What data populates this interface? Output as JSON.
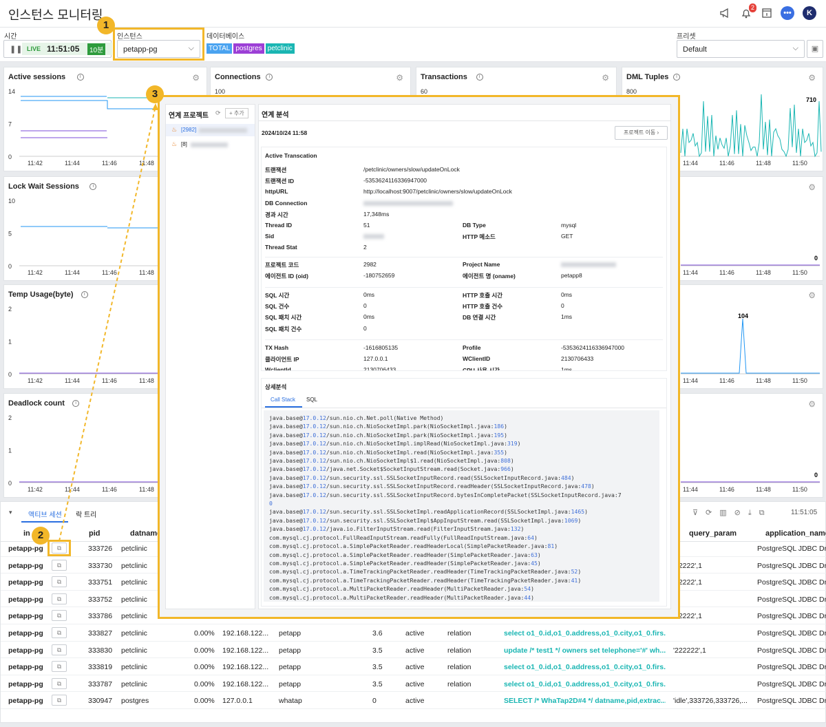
{
  "app": {
    "title": "인스턴스 모니터링",
    "notif_count": "2",
    "avatar": "K"
  },
  "filters": {
    "time_label": "시간",
    "live": "LIVE",
    "time": "11:51:05",
    "range": "10분",
    "instance_label": "인스턴스",
    "instance_value": "petapp-pg",
    "db_label": "데이터베이스",
    "db_tags": [
      "TOTAL",
      "postgres",
      "petclinic"
    ],
    "preset_label": "프리셋",
    "preset_value": "Default"
  },
  "colors": {
    "accent": "#2196f3",
    "teal": "#1ab6b3",
    "purple": "#7b4bd8",
    "callout": "#f2b729"
  },
  "panels": [
    {
      "title": "Active sessions",
      "y": [
        "14",
        "7",
        "0"
      ],
      "x": [
        "11:42",
        "11:44",
        "11:46",
        "11:48"
      ]
    },
    {
      "title": "Connections",
      "y": [
        "100"
      ],
      "x": []
    },
    {
      "title": "Transactions",
      "y": [
        "60"
      ],
      "x": []
    },
    {
      "title": "DML Tuples",
      "y": [
        "800"
      ],
      "x": [
        "11:44",
        "11:46",
        "11:48",
        "11:50"
      ],
      "peak": "710"
    },
    {
      "title": "Lock Wait Sessions",
      "y": [
        "10",
        "5",
        "0"
      ],
      "x": [
        "11:42",
        "11:44",
        "11:46",
        "11:48"
      ]
    },
    {
      "title": "",
      "x": [
        "11:44",
        "11:46",
        "11:48",
        "11:50"
      ],
      "peak": "0"
    },
    {
      "title": "Temp Usage(byte)",
      "y": [
        "2",
        "1",
        "0"
      ],
      "x": [
        "11:42",
        "11:44",
        "11:46",
        "11:48"
      ]
    },
    {
      "title": "",
      "x": [
        "11:44",
        "11:46",
        "11:48",
        "11:50"
      ],
      "peak": "104"
    },
    {
      "title": "Deadlock count",
      "y": [
        "2",
        "1",
        "0"
      ],
      "x": [
        "11:42",
        "11:44",
        "11:46",
        "11:48"
      ]
    },
    {
      "title": "",
      "x": [
        "11:44",
        "11:46",
        "11:48",
        "11:50"
      ],
      "peak": "0"
    }
  ],
  "table": {
    "tabs": [
      "액티브 세션",
      "락 트리"
    ],
    "time": "11:51:05",
    "headers": [
      "in",
      "pid",
      "datname",
      "query_param",
      "application_name"
    ],
    "rows": [
      {
        "inst": "petapp-pg",
        "pid": "333726",
        "db": "petclinic",
        "cpu": "",
        "ip": "",
        "user": "",
        "time": "",
        "state": "",
        "wait": "",
        "query": "",
        "param": "",
        "app": "PostgreSQL JDBC Dr"
      },
      {
        "inst": "petapp-pg",
        "pid": "333730",
        "db": "petclinic",
        "cpu": "",
        "ip": "",
        "user": "",
        "time": "",
        "state": "",
        "wait": "",
        "query": "",
        "param": "'22222',1",
        "app": "PostgreSQL JDBC Dr"
      },
      {
        "inst": "petapp-pg",
        "pid": "333751",
        "db": "petclinic",
        "cpu": "",
        "ip": "",
        "user": "",
        "time": "",
        "state": "",
        "wait": "",
        "query": "",
        "param": "'22222',1",
        "app": "PostgreSQL JDBC Dr"
      },
      {
        "inst": "petapp-pg",
        "pid": "333752",
        "db": "petclinic",
        "cpu": "",
        "ip": "",
        "user": "",
        "time": "",
        "state": "",
        "wait": "",
        "query": "",
        "param": "",
        "app": "PostgreSQL JDBC Dr"
      },
      {
        "inst": "petapp-pg",
        "pid": "333786",
        "db": "petclinic",
        "cpu": "",
        "ip": "",
        "user": "",
        "time": "",
        "state": "",
        "wait": "",
        "query": "",
        "param": "'22222',1",
        "app": "PostgreSQL JDBC Dr"
      },
      {
        "inst": "petapp-pg",
        "pid": "333827",
        "db": "petclinic",
        "cpu": "0.00%",
        "ip": "192.168.122...",
        "user": "petapp",
        "time": "3.6",
        "state": "active",
        "wait": "relation",
        "query": "select o1_0.id,o1_0.address,o1_0.city,o1_0.firs...",
        "param": "",
        "app": "PostgreSQL JDBC Dr"
      },
      {
        "inst": "petapp-pg",
        "pid": "333830",
        "db": "petclinic",
        "cpu": "0.00%",
        "ip": "192.168.122...",
        "user": "petapp",
        "time": "3.5",
        "state": "active",
        "wait": "relation",
        "query": "update /* test1 */ owners set telephone='#' wh...",
        "param": "'222222',1",
        "app": "PostgreSQL JDBC Dr"
      },
      {
        "inst": "petapp-pg",
        "pid": "333819",
        "db": "petclinic",
        "cpu": "0.00%",
        "ip": "192.168.122...",
        "user": "petapp",
        "time": "3.5",
        "state": "active",
        "wait": "relation",
        "query": "select o1_0.id,o1_0.address,o1_0.city,o1_0.firs...",
        "param": "",
        "app": "PostgreSQL JDBC Dr"
      },
      {
        "inst": "petapp-pg",
        "pid": "333787",
        "db": "petclinic",
        "cpu": "0.00%",
        "ip": "192.168.122...",
        "user": "petapp",
        "time": "3.5",
        "state": "active",
        "wait": "relation",
        "query": "select o1_0.id,o1_0.address,o1_0.city,o1_0.firs...",
        "param": "",
        "app": "PostgreSQL JDBC Dr"
      },
      {
        "inst": "petapp-pg",
        "pid": "330947",
        "db": "postgres",
        "cpu": "0.00%",
        "ip": "127.0.0.1",
        "user": "whatap",
        "time": "0",
        "state": "active",
        "wait": "",
        "query": "SELECT /* WhaTap2D#4 */ datname,pid,extrac...",
        "param": "'idle',333726,333726,...",
        "app": "PostgreSQL JDBC Dr"
      }
    ]
  },
  "modal": {
    "left_title": "연계 프로젝트",
    "add": "+ 추가",
    "projects": [
      "[2982]",
      "[8]"
    ],
    "right_title": "연계 분석",
    "date": "2024/10/24 11:58",
    "move": "프로젝트 이동",
    "section": "Active Transcation",
    "fields1": [
      [
        "트랜잭션",
        "/petclinic/owners/slow/updateOnLock"
      ],
      [
        "트랜잭션 ID",
        "-5353624116336947000"
      ],
      [
        "httpURL",
        "http://localhost:9007/petclinic/owners/slow/updateOnLock"
      ],
      [
        "DB Connection",
        ""
      ],
      [
        "경과 시간",
        "17,348ms"
      ],
      [
        "Thread ID",
        "51"
      ],
      [
        "Sid",
        ""
      ],
      [
        "Thread Stat",
        "2"
      ]
    ],
    "fields1r": [
      [
        "DB Type",
        "mysql"
      ],
      [
        "HTTP 메소드",
        "GET"
      ]
    ],
    "fields2": [
      [
        "프로젝트 코드",
        "2982"
      ],
      [
        "에이전트 ID (oid)",
        "-180752659"
      ]
    ],
    "fields2r": [
      [
        "Project Name",
        ""
      ],
      [
        "에이전트 명 (oname)",
        "petapp8"
      ]
    ],
    "fields3": [
      [
        "SQL 시간",
        "0ms"
      ],
      [
        "SQL 건수",
        "0"
      ],
      [
        "SQL 패치 시간",
        "0ms"
      ],
      [
        "SQL 패치 건수",
        "0"
      ]
    ],
    "fields3r": [
      [
        "HTTP 호출 시간",
        "0ms"
      ],
      [
        "HTTP 호출 건수",
        "0"
      ],
      [
        "DB 연결 시간",
        "1ms"
      ]
    ],
    "fields4": [
      [
        "TX Hash",
        "-1616805135"
      ],
      [
        "클라이언트 IP",
        "127.0.0.1"
      ],
      [
        "WclientId",
        "2130706433"
      ]
    ],
    "fields4r": [
      [
        "Profile",
        "-5353624116336947000"
      ],
      [
        "WClientID",
        "2130706433"
      ],
      [
        "CPU 사용 시간",
        "1ms"
      ]
    ],
    "detail_title": "상세분석",
    "detail_tabs": [
      "Call Stack",
      "SQL"
    ],
    "stack": [
      [
        "java.base@",
        "17.0.12",
        "/sun.nio.ch.Net.poll(Native Method)",
        ""
      ],
      [
        "java.base@",
        "17.0.12",
        "/sun.nio.ch.NioSocketImpl.park(NioSocketImpl.java:",
        "186"
      ],
      [
        "java.base@",
        "17.0.12",
        "/sun.nio.ch.NioSocketImpl.park(NioSocketImpl.java:",
        "195"
      ],
      [
        "java.base@",
        "17.0.12",
        "/sun.nio.ch.NioSocketImpl.implRead(NioSocketImpl.java:",
        "319"
      ],
      [
        "java.base@",
        "17.0.12",
        "/sun.nio.ch.NioSocketImpl.read(NioSocketImpl.java:",
        "355"
      ],
      [
        "java.base@",
        "17.0.12",
        "/sun.nio.ch.NioSocketImpl$1.read(NioSocketImpl.java:",
        "808"
      ],
      [
        "java.base@",
        "17.0.12",
        "/java.net.Socket$SocketInputStream.read(Socket.java:",
        "966"
      ],
      [
        "java.base@",
        "17.0.12",
        "/sun.security.ssl.SSLSocketInputRecord.read(SSLSocketInputRecord.java:",
        "484"
      ],
      [
        "java.base@",
        "17.0.12",
        "/sun.security.ssl.SSLSocketInputRecord.readHeader(SSLSocketInputRecord.java:",
        "478"
      ],
      [
        "java.base@",
        "17.0.12",
        "/sun.security.ssl.SSLSocketInputRecord.bytesInCompletePacket(SSLSocketInputRecord.java:7",
        ""
      ],
      [
        "",
        "",
        "",
        "0"
      ],
      [
        "java.base@",
        "17.0.12",
        "/sun.security.ssl.SSLSocketImpl.readApplicationRecord(SSLSocketImpl.java:",
        "1465"
      ],
      [
        "java.base@",
        "17.0.12",
        "/sun.security.ssl.SSLSocketImpl$AppInputStream.read(SSLSocketImpl.java:",
        "1069"
      ],
      [
        "java.base@",
        "17.0.12",
        "/java.io.FilterInputStream.read(FilterInputStream.java:",
        "132"
      ],
      [
        "com.mysql.cj.protocol.FullReadInputStream.readFully(FullReadInputStream.java:",
        "",
        "",
        "64"
      ],
      [
        "com.mysql.cj.protocol.a.SimplePacketReader.readHeaderLocal(SimplePacketReader.java:",
        "",
        "",
        "81"
      ],
      [
        "com.mysql.cj.protocol.a.SimplePacketReader.readHeader(SimplePacketReader.java:",
        "",
        "",
        "63"
      ],
      [
        "com.mysql.cj.protocol.a.SimplePacketReader.readHeader(SimplePacketReader.java:",
        "",
        "",
        "45"
      ],
      [
        "com.mysql.cj.protocol.a.TimeTrackingPacketReader.readHeader(TimeTrackingPacketReader.java:",
        "",
        "",
        "52"
      ],
      [
        "com.mysql.cj.protocol.a.TimeTrackingPacketReader.readHeader(TimeTrackingPacketReader.java:",
        "",
        "",
        "41"
      ],
      [
        "com.mysql.cj.protocol.a.MultiPacketReader.readHeader(MultiPacketReader.java:",
        "",
        "",
        "54"
      ],
      [
        "com.mysql.cj.protocol.a.MultiPacketReader.readHeader(MultiPacketReader.java:",
        "",
        "",
        "44"
      ]
    ]
  },
  "callouts": [
    "1",
    "2",
    "3"
  ]
}
